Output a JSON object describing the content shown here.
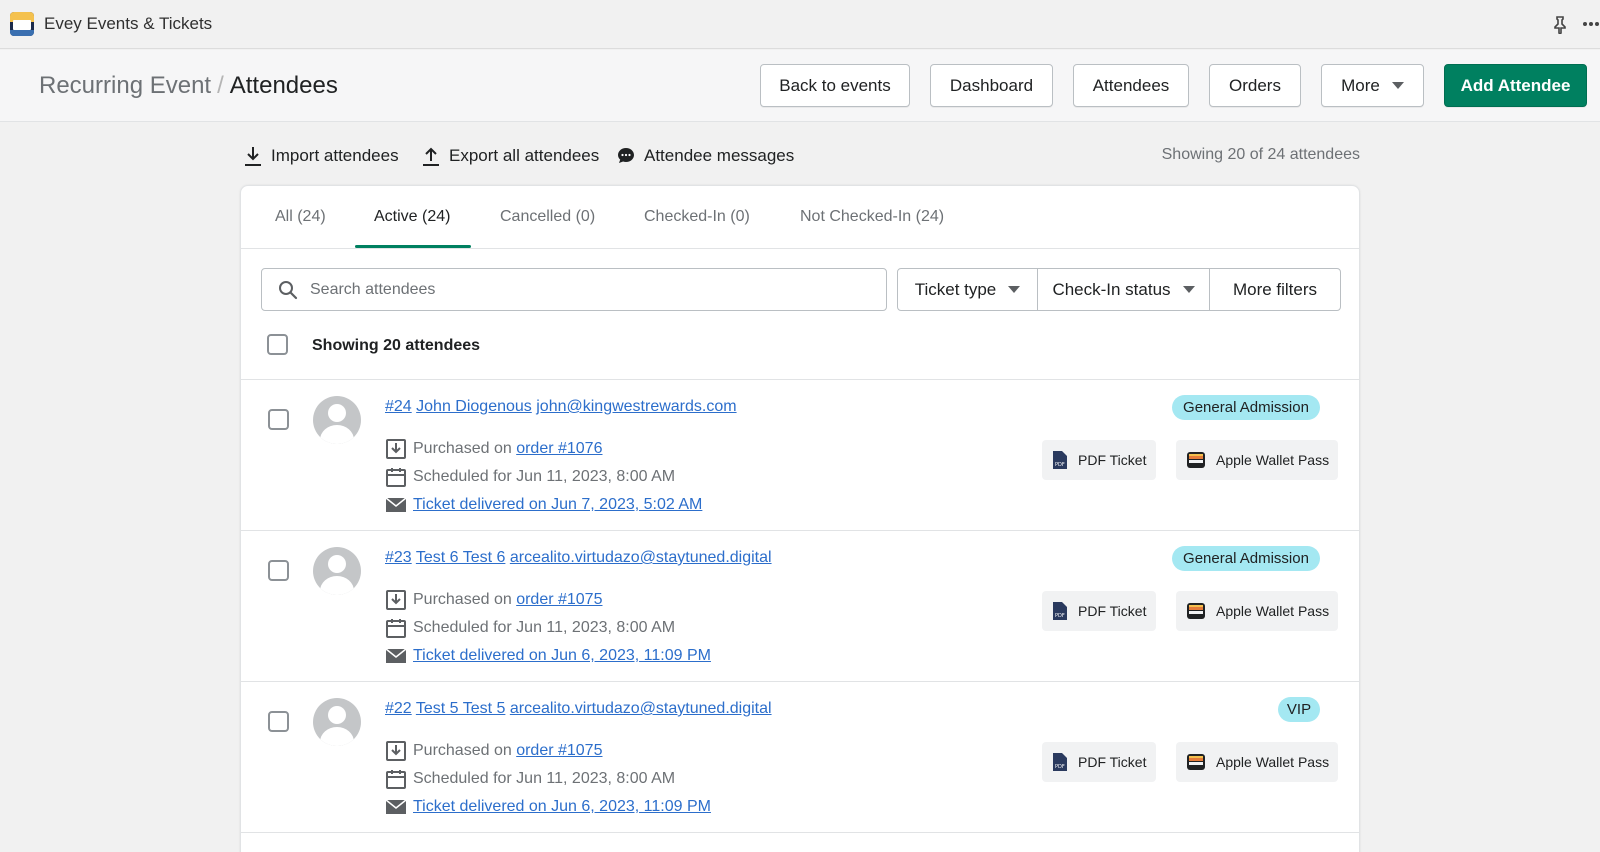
{
  "app": {
    "title": "Evey Events & Tickets",
    "icon": "evey-logo"
  },
  "header": {
    "breadcrumb_parent": "Recurring Event",
    "breadcrumb_sep": "/",
    "breadcrumb_current": "Attendees",
    "buttons": {
      "back": "Back to events",
      "dashboard": "Dashboard",
      "attendees": "Attendees",
      "orders": "Orders",
      "more": "More",
      "add": "Add Attendee"
    }
  },
  "actions": {
    "import": "Import attendees",
    "export": "Export all attendees",
    "messages": "Attendee messages",
    "showing_total": "Showing 20 of 24 attendees"
  },
  "tabs": [
    {
      "label": "All (24)"
    },
    {
      "label": "Active (24)",
      "active": true
    },
    {
      "label": "Cancelled (0)"
    },
    {
      "label": "Checked-In (0)"
    },
    {
      "label": "Not Checked-In (24)"
    }
  ],
  "search": {
    "placeholder": "Search attendees",
    "value": ""
  },
  "filters": {
    "ticket_type": "Ticket type",
    "checkin_status": "Check-In status",
    "more": "More filters"
  },
  "selection": {
    "label": "Showing 20 attendees"
  },
  "ticket_buttons": {
    "pdf": "PDF Ticket",
    "wallet": "Apple Wallet Pass"
  },
  "attendees": [
    {
      "number": "#24",
      "name": "John Diogenous",
      "email": "john@kingwestrewards.com",
      "purchased_prefix": "Purchased on",
      "order": "order #1076",
      "scheduled": "Scheduled for Jun 11, 2023, 8:00 AM",
      "delivered": "Ticket delivered on Jun 7, 2023, 5:02 AM",
      "ticket_type": "General Admission"
    },
    {
      "number": "#23",
      "name": "Test 6 Test 6",
      "email": "arcealito.virtudazo@staytuned.digital",
      "purchased_prefix": "Purchased on",
      "order": "order #1075",
      "scheduled": "Scheduled for Jun 11, 2023, 8:00 AM",
      "delivered": "Ticket delivered on Jun 6, 2023, 11:09 PM",
      "ticket_type": "General Admission"
    },
    {
      "number": "#22",
      "name": "Test 5 Test 5",
      "email": "arcealito.virtudazo@staytuned.digital",
      "purchased_prefix": "Purchased on",
      "order": "order #1075",
      "scheduled": "Scheduled for Jun 11, 2023, 8:00 AM",
      "delivered": "Ticket delivered on Jun 6, 2023, 11:09 PM",
      "ticket_type": "VIP"
    }
  ],
  "colors": {
    "primary": "#008060",
    "link": "#2c6ecb",
    "badge": "#a4e8f2"
  }
}
